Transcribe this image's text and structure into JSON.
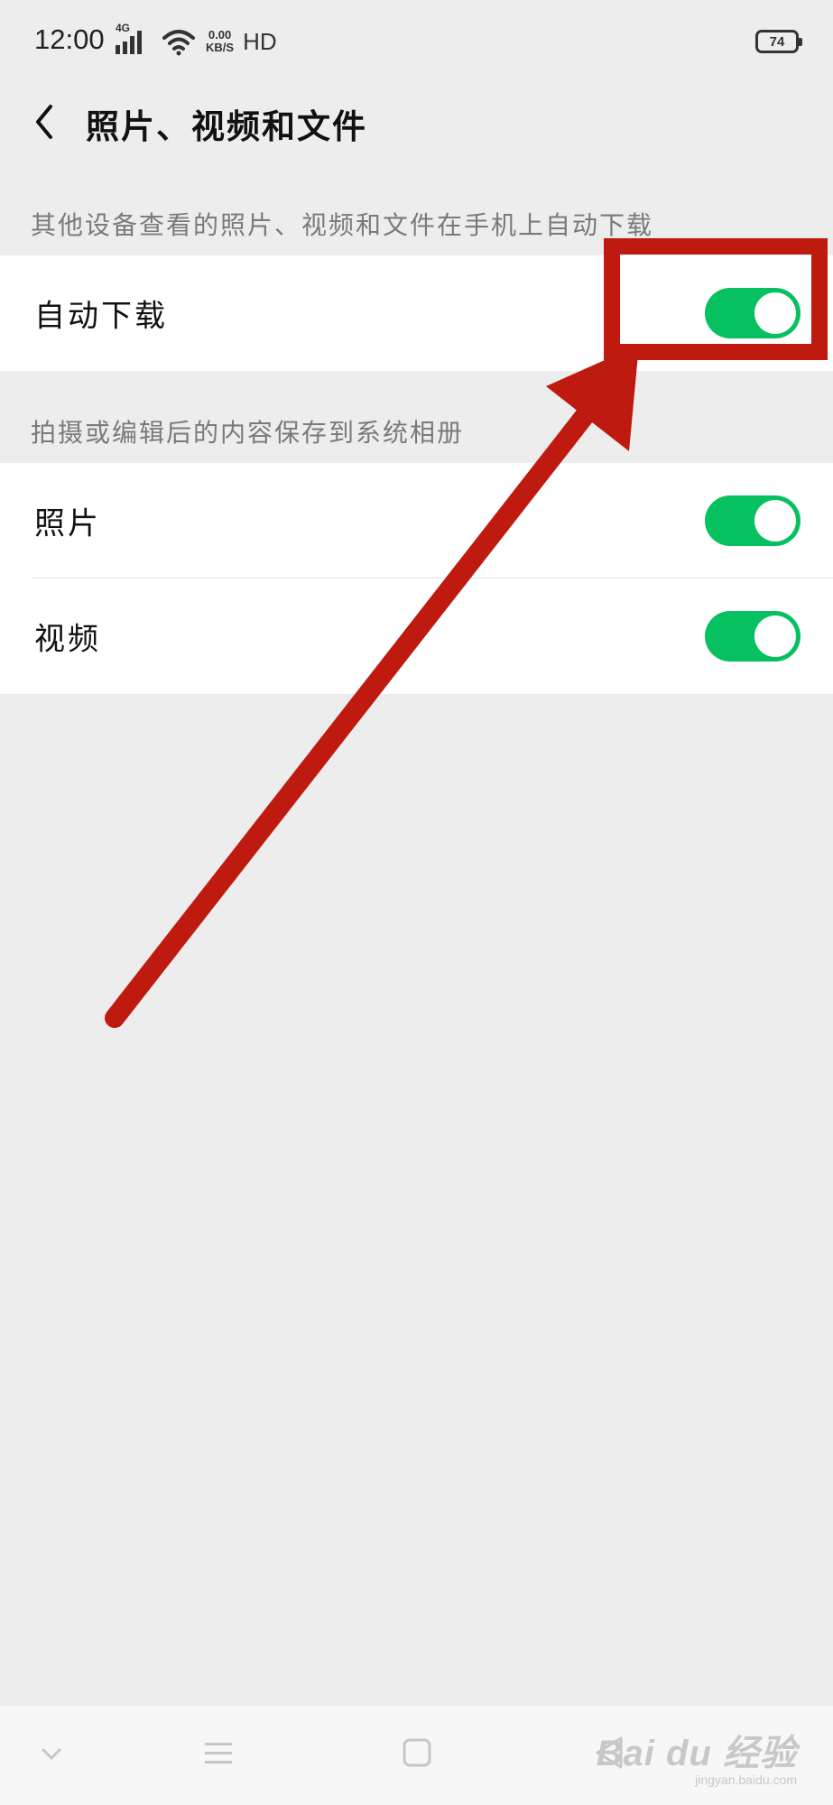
{
  "status_bar": {
    "time": "12:00",
    "network_type": "4G",
    "speed_value": "0.00",
    "speed_unit": "KB/S",
    "hd_label": "HD",
    "battery_level": "74",
    "icons": [
      "signal-icon",
      "wifi-icon",
      "battery-icon"
    ]
  },
  "header": {
    "back_icon": "chevron-left-icon",
    "title": "照片、视频和文件"
  },
  "section_auto_download": {
    "caption": "其他设备查看的照片、视频和文件在手机上自动下载",
    "items": [
      {
        "label": "自动下载",
        "enabled": true
      }
    ]
  },
  "section_save_to_album": {
    "caption": "拍摄或编辑后的内容保存到系统相册",
    "items": [
      {
        "label": "照片",
        "enabled": true
      },
      {
        "label": "视频",
        "enabled": true
      }
    ]
  },
  "colors": {
    "toggle_on": "#07c160",
    "annotation": "#bf1a10",
    "background": "#ededed"
  },
  "navigation": {
    "icons": [
      "chevron-down-icon",
      "menu-icon",
      "home-square-icon",
      "back-triangle-icon"
    ]
  },
  "watermark": {
    "brand": "Bai du 经验",
    "url": "jingyan.baidu.com"
  }
}
